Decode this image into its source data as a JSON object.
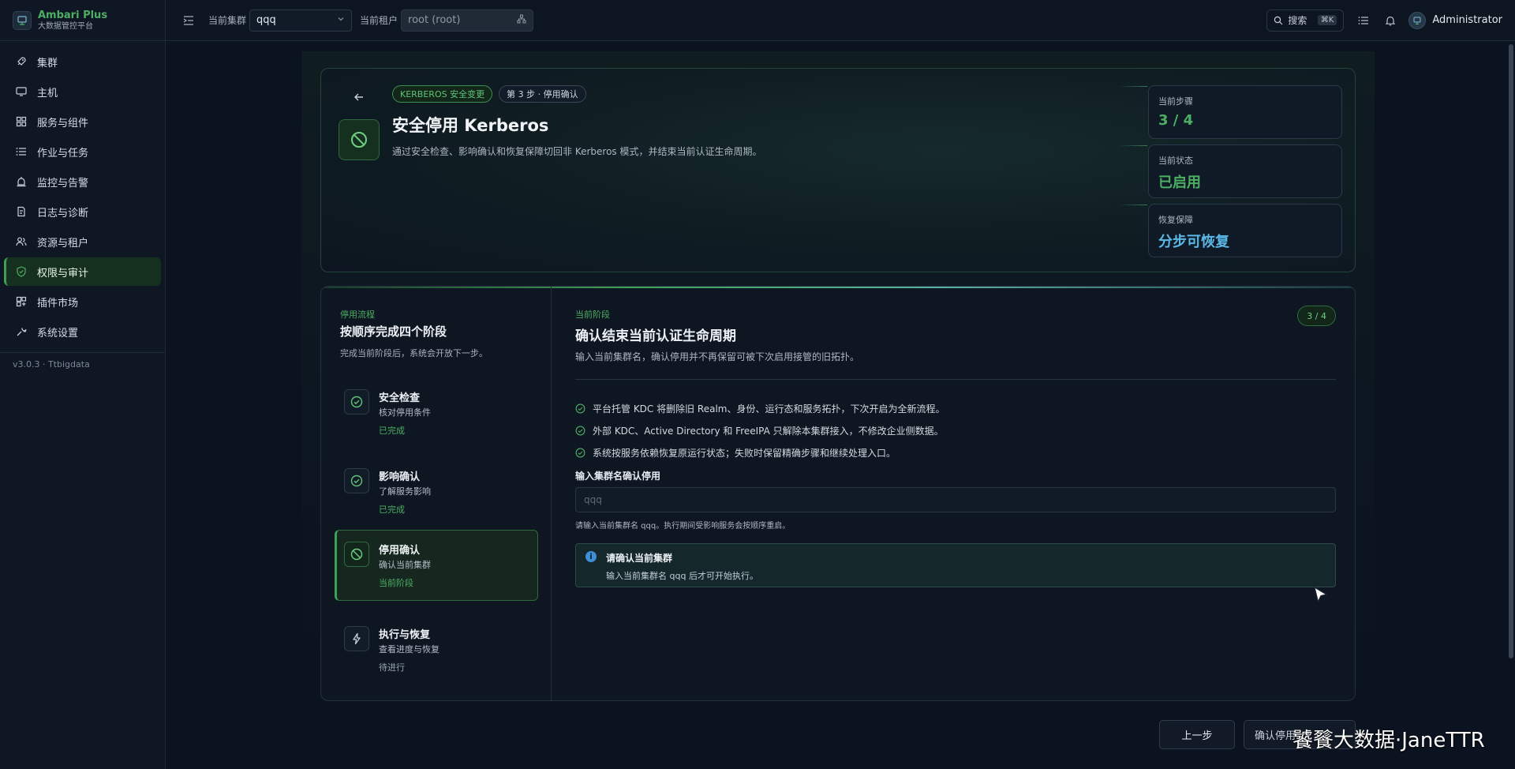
{
  "brand": {
    "title": "Ambari Plus",
    "subtitle": "大数据管控平台"
  },
  "sidebar": {
    "items": [
      {
        "label": "集群",
        "icon": "rocket-icon"
      },
      {
        "label": "主机",
        "icon": "monitor-icon"
      },
      {
        "label": "服务与组件",
        "icon": "grid-icon"
      },
      {
        "label": "作业与任务",
        "icon": "list-icon"
      },
      {
        "label": "监控与告警",
        "icon": "alarm-icon"
      },
      {
        "label": "日志与诊断",
        "icon": "log-icon"
      },
      {
        "label": "资源与租户",
        "icon": "users-icon"
      },
      {
        "label": "权限与审计",
        "icon": "shield-icon",
        "active": true
      },
      {
        "label": "插件市场",
        "icon": "plugin-icon"
      },
      {
        "label": "系统设置",
        "icon": "wrench-icon"
      }
    ],
    "version": "v3.0.3 · Ttbigdata"
  },
  "topbar": {
    "cluster_label": "当前集群",
    "cluster_value": "qqq",
    "tenant_label": "当前租户",
    "tenant_value": "root (root)",
    "search_label": "搜索",
    "search_shortcut": "⌘K",
    "user_name": "Administrator"
  },
  "hero": {
    "tag_primary": "KERBEROS 安全变更",
    "tag_step": "第 3 步 · 停用确认",
    "title": "安全停用 Kerberos",
    "description": "通过安全检查、影响确认和恢复保障切回非 Kerberos 模式，并结束当前认证生命周期。",
    "stats": [
      {
        "label": "当前步骤",
        "value": "3 / 4",
        "color": "#4caf63"
      },
      {
        "label": "当前状态",
        "value": "已启用",
        "color": "#4caf63"
      },
      {
        "label": "恢复保障",
        "value": "分步可恢复",
        "color": "#5bb8e6"
      }
    ]
  },
  "steps": {
    "kicker": "停用流程",
    "title": "按顺序完成四个阶段",
    "hint": "完成当前阶段后，系统会开放下一步。",
    "items": [
      {
        "name": "安全检查",
        "desc": "核对停用条件",
        "status": "已完成"
      },
      {
        "name": "影响确认",
        "desc": "了解服务影响",
        "status": "已完成"
      },
      {
        "name": "停用确认",
        "desc": "确认当前集群",
        "status": "当前阶段"
      },
      {
        "name": "执行与恢复",
        "desc": "查看进度与恢复",
        "status": "待进行"
      }
    ]
  },
  "content": {
    "kicker": "当前阶段",
    "title": "确认结束当前认证生命周期",
    "description": "输入当前集群名，确认停用并不再保留可被下次启用接管的旧拓扑。",
    "badge": "3 / 4",
    "bullets": [
      "平台托管 KDC 将删除旧 Realm、身份、运行态和服务拓扑，下次开启为全新流程。",
      "外部 KDC、Active Directory 和 FreeIPA 只解除本集群接入，不修改企业侧数据。",
      "系统按服务依赖恢复原运行状态；失败时保留精确步骤和继续处理入口。"
    ],
    "field_label": "输入集群名确认停用",
    "field_placeholder": "qqq",
    "field_value": "",
    "field_hint": "请输入当前集群名 qqq。执行期间受影响服务会按顺序重启。",
    "notice_title": "请确认当前集群",
    "notice_text": "输入当前集群名 qqq 后才可开始执行。"
  },
  "footer": {
    "prev_label": "上一步",
    "confirm_label": "确认停用"
  },
  "watermark": "饕餮大数据·JaneTTR"
}
